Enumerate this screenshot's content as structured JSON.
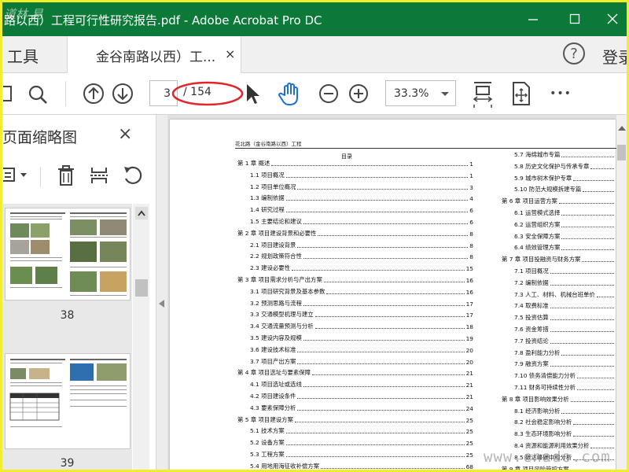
{
  "window": {
    "title": "路以西）工程可行性研究报告.pdf - Adobe Acrobat Pro DC",
    "watermark_top": "道林 易"
  },
  "tabs": {
    "tools_label": "工具",
    "doc_tab_label": "金谷南路以西）工...",
    "doc_tab_close": "×",
    "help_label": "?",
    "login_label": "登录"
  },
  "toolbar": {
    "current_page": "3",
    "total_pages": "/ 154",
    "zoom": "33.3%",
    "more_label": "•••",
    "annotation_color": "#e0262b"
  },
  "left_panel": {
    "title": "页面缩略图",
    "close_label": "×",
    "thumbnails": [
      {
        "page": "38"
      },
      {
        "page": "39"
      }
    ]
  },
  "document": {
    "header": "花北路（金谷南路以西）工程",
    "toc_title": "目录",
    "toc_left": [
      {
        "label": "第 1 章  概述",
        "page": "1",
        "level": 1
      },
      {
        "label": "1.1  项目概况",
        "page": "1",
        "level": 2
      },
      {
        "label": "1.2  项目单位概况",
        "page": "3",
        "level": 2
      },
      {
        "label": "1.3  编制依据",
        "page": "4",
        "level": 2
      },
      {
        "label": "1.4  研究过程",
        "page": "6",
        "level": 2
      },
      {
        "label": "1.5  主要结论和建议",
        "page": "6",
        "level": 2
      },
      {
        "label": "第 2 章  项目建设背景和必要性",
        "page": "8",
        "level": 1
      },
      {
        "label": "2.1  项目建设背景",
        "page": "8",
        "level": 2
      },
      {
        "label": "2.2  规划政策符合性",
        "page": "8",
        "level": 2
      },
      {
        "label": "2.3  建设必要性",
        "page": "15",
        "level": 2
      },
      {
        "label": "第 3 章  项目需求分析与产出方案",
        "page": "16",
        "level": 1
      },
      {
        "label": "3.1  项目研究背景及基本参数",
        "page": "16",
        "level": 2
      },
      {
        "label": "3.2  预测思路与流程",
        "page": "17",
        "level": 2
      },
      {
        "label": "3.3  交通模型机理与建立",
        "page": "17",
        "level": 2
      },
      {
        "label": "3.4  交通流量预测与分析",
        "page": "18",
        "level": 2
      },
      {
        "label": "3.5  建设内容及规模",
        "page": "19",
        "level": 2
      },
      {
        "label": "3.6  建设技术标准",
        "page": "20",
        "level": 2
      },
      {
        "label": "3.7  项目产出方案",
        "page": "20",
        "level": 2
      },
      {
        "label": "第 4 章  项目选址与要素保障",
        "page": "21",
        "level": 1
      },
      {
        "label": "4.1  项目选址或选线",
        "page": "21",
        "level": 2
      },
      {
        "label": "4.2  项目建设条件",
        "page": "21",
        "level": 2
      },
      {
        "label": "4.3  要素保障分析",
        "page": "24",
        "level": 2
      },
      {
        "label": "第 5 章  项目建设方案",
        "page": "25",
        "level": 1
      },
      {
        "label": "5.1  技术方案",
        "page": "25",
        "level": 2
      },
      {
        "label": "5.2  设备方案",
        "page": "25",
        "level": 2
      },
      {
        "label": "5.3  工程方案",
        "page": "25",
        "level": 2
      },
      {
        "label": "5.4  用地用海征收补偿方案",
        "page": "68",
        "level": 2
      }
    ],
    "toc_right": [
      {
        "label": "5.7  海绵城市专篇",
        "page": "",
        "level": 2
      },
      {
        "label": "5.8  历史文化保护与传承专章",
        "page": "",
        "level": 2
      },
      {
        "label": "5.9  城市树木保护专章",
        "page": "",
        "level": 2
      },
      {
        "label": "5.10  防范大规模拆建专篇",
        "page": "",
        "level": 2
      },
      {
        "label": "第 6 章  项目运营方案",
        "page": "",
        "level": 1
      },
      {
        "label": "6.1  运营模式选择",
        "page": "",
        "level": 2
      },
      {
        "label": "6.2  运营组织方案",
        "page": "",
        "level": 2
      },
      {
        "label": "6.3  安全保障方案",
        "page": "",
        "level": 2
      },
      {
        "label": "6.4  绩效管理方案",
        "page": "",
        "level": 2
      },
      {
        "label": "第 7 章  项目投融资与财务方案",
        "page": "",
        "level": 1
      },
      {
        "label": "7.1  项目概况",
        "page": "",
        "level": 2
      },
      {
        "label": "7.2  编制依据",
        "page": "",
        "level": 2
      },
      {
        "label": "7.3  人工、材料、机械台班单价",
        "page": "",
        "level": 2
      },
      {
        "label": "7.4  取费标准",
        "page": "",
        "level": 2
      },
      {
        "label": "7.5  投资估算",
        "page": "",
        "level": 2
      },
      {
        "label": "7.6  资金筹措",
        "page": "",
        "level": 2
      },
      {
        "label": "7.7  投资结论",
        "page": "",
        "level": 2
      },
      {
        "label": "7.8  盈利能力分析",
        "page": "",
        "level": 2
      },
      {
        "label": "7.9  融资方案",
        "page": "",
        "level": 2
      },
      {
        "label": "7.10  债务清偿能力分析",
        "page": "",
        "level": 2
      },
      {
        "label": "7.11  财务可持续性分析",
        "page": "",
        "level": 2
      },
      {
        "label": "第 8 章  项目影响效果分析",
        "page": "",
        "level": 1
      },
      {
        "label": "8.1  经济影响分析",
        "page": "",
        "level": 2
      },
      {
        "label": "8.2  社会稳定影响分析",
        "page": "",
        "level": 2
      },
      {
        "label": "8.3  生态环境影响分析",
        "page": "",
        "level": 2
      },
      {
        "label": "8.4  资源和能源利用效果分析",
        "page": "",
        "level": 2
      },
      {
        "label": "8.5  碳达峰碳中和分析",
        "page": "",
        "level": 2
      },
      {
        "label": "第 9 章  项目风险管控方案",
        "page": "",
        "level": 1
      }
    ],
    "watermark": "www.cnado.com"
  }
}
